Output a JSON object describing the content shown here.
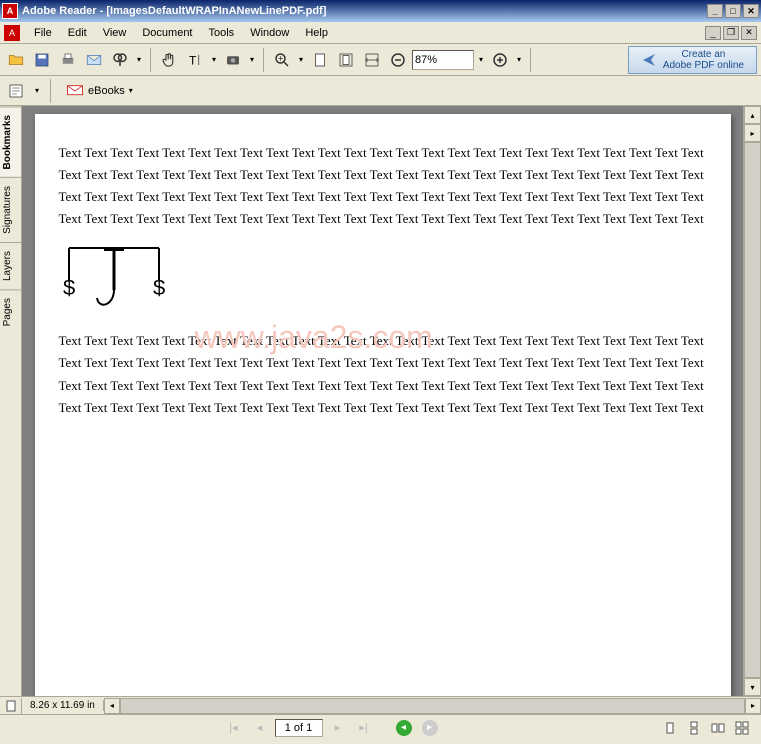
{
  "title": "Adobe Reader - [ImagesDefaultWRAPInANewLinePDF.pdf]",
  "menus": [
    "File",
    "Edit",
    "View",
    "Document",
    "Tools",
    "Window",
    "Help"
  ],
  "toolbar": {
    "zoom_value": "87%",
    "create_line1": "Create an",
    "create_line2": "Adobe PDF online"
  },
  "toolbar2": {
    "ebooks": "eBooks"
  },
  "side_tabs": [
    "Bookmarks",
    "Signatures",
    "Layers",
    "Pages"
  ],
  "document": {
    "para1": "Text Text Text Text Text Text Text Text Text Text Text Text Text Text Text Text Text Text Text Text Text Text Text Text Text Text Text Text Text Text Text Text Text Text Text Text Text Text Text Text Text Text Text Text Text Text Text Text Text Text Text Text Text Text Text Text Text Text Text Text Text Text Text Text Text Text Text Text Text Text Text Text Text Text Text Text Text Text Text Text Text Text Text Text Text Text Text Text Text Text Text Text Text Text Text Text Text Text Text Text",
    "para2": "Text Text Text Text Text Text Text Text Text Text Text Text Text Text Text Text Text Text Text Text Text Text Text Text Text Text Text Text Text Text Text Text Text Text Text Text Text Text Text Text Text Text Text Text Text Text Text Text Text Text Text Text Text Text Text Text Text Text Text Text Text Text Text Text Text Text Text Text Text Text Text Text Text Text Text Text Text Text Text Text Text Text Text Text Text Text Text Text Text Text Text Text Text Text Text Text Text Text Text Text",
    "watermark": "www.java2s.com"
  },
  "statusbar": {
    "dimensions": "8.26 x 11.69 in"
  },
  "navbar": {
    "page_display": "1 of 1"
  }
}
